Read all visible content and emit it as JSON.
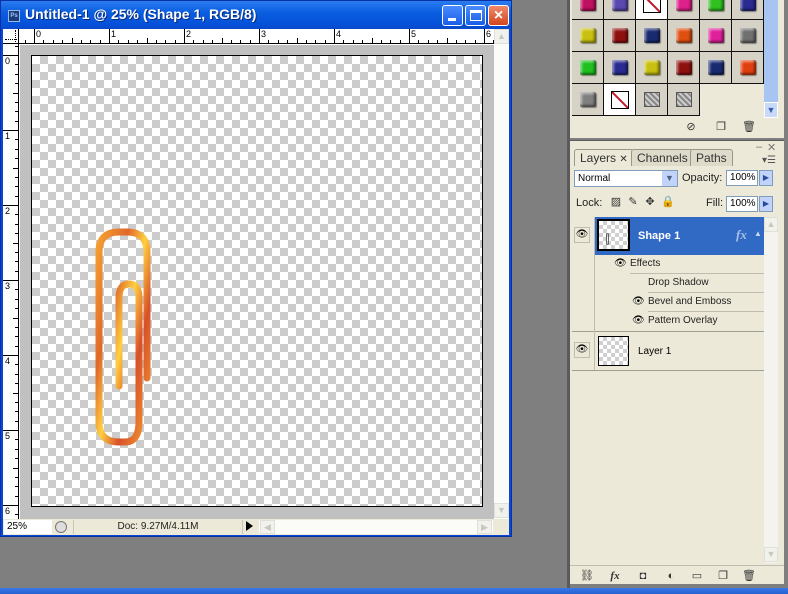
{
  "window": {
    "title": "Untitled-1 @ 25% (Shape 1, RGB/8)",
    "app_icon_label": "Ps",
    "buttons": {
      "minimize": "minimize",
      "maximize": "maximize",
      "close": "×"
    }
  },
  "rulers": {
    "horizontal_labels": [
      "0",
      "1",
      "2",
      "3",
      "4",
      "5",
      "6"
    ],
    "vertical_labels": [
      "0",
      "1",
      "2",
      "3",
      "4",
      "5",
      "6"
    ]
  },
  "canvas": {
    "content": "paperclip-shape",
    "clip_colors": {
      "outer": "#f0962a",
      "mid": "#d84a20",
      "highlight": "#ffd84a"
    }
  },
  "status_bar": {
    "zoom": "25%",
    "doc_info": "Doc: 9.27M/4.11M"
  },
  "styles_panel": {
    "rows": [
      [
        "#c01060",
        "#5a4ab0",
        "none",
        "#e0208a",
        "#30c020",
        "#2a2a90"
      ],
      [
        "#c8c010",
        "#901010",
        "#1a2a70",
        "#e05010",
        "#e0209a",
        "#707070"
      ],
      [
        "#20c020",
        "#2a2a90",
        "#c8c010",
        "#901010",
        "#1a2a70",
        "#e04010"
      ],
      [
        "#808080",
        "none",
        "pattern",
        "pattern"
      ]
    ],
    "footer_icons": [
      "clear-style-icon",
      "new-style-icon",
      "delete-style-icon"
    ]
  },
  "layers_panel": {
    "tabs": [
      {
        "label": "Layers",
        "active": true,
        "closable": true
      },
      {
        "label": "Channels",
        "active": false
      },
      {
        "label": "Paths",
        "active": false
      }
    ],
    "blend_mode": "Normal",
    "opacity_label": "Opacity:",
    "opacity_value": "100%",
    "lock_label": "Lock:",
    "fill_label": "Fill:",
    "fill_value": "100%",
    "layers": [
      {
        "name": "Shape 1",
        "selected": true,
        "visible": true,
        "fx": "fx",
        "effects_label": "Effects",
        "effects": [
          {
            "name": "Drop Shadow",
            "visible": false
          },
          {
            "name": "Bevel and Emboss",
            "visible": true
          },
          {
            "name": "Pattern Overlay",
            "visible": true
          }
        ]
      },
      {
        "name": "Layer 1",
        "selected": false,
        "visible": true
      }
    ],
    "footer_icons": [
      "link-layers-icon",
      "fx-icon",
      "add-mask-icon",
      "adjustment-layer-icon",
      "new-group-icon",
      "new-layer-icon",
      "delete-layer-icon"
    ]
  }
}
